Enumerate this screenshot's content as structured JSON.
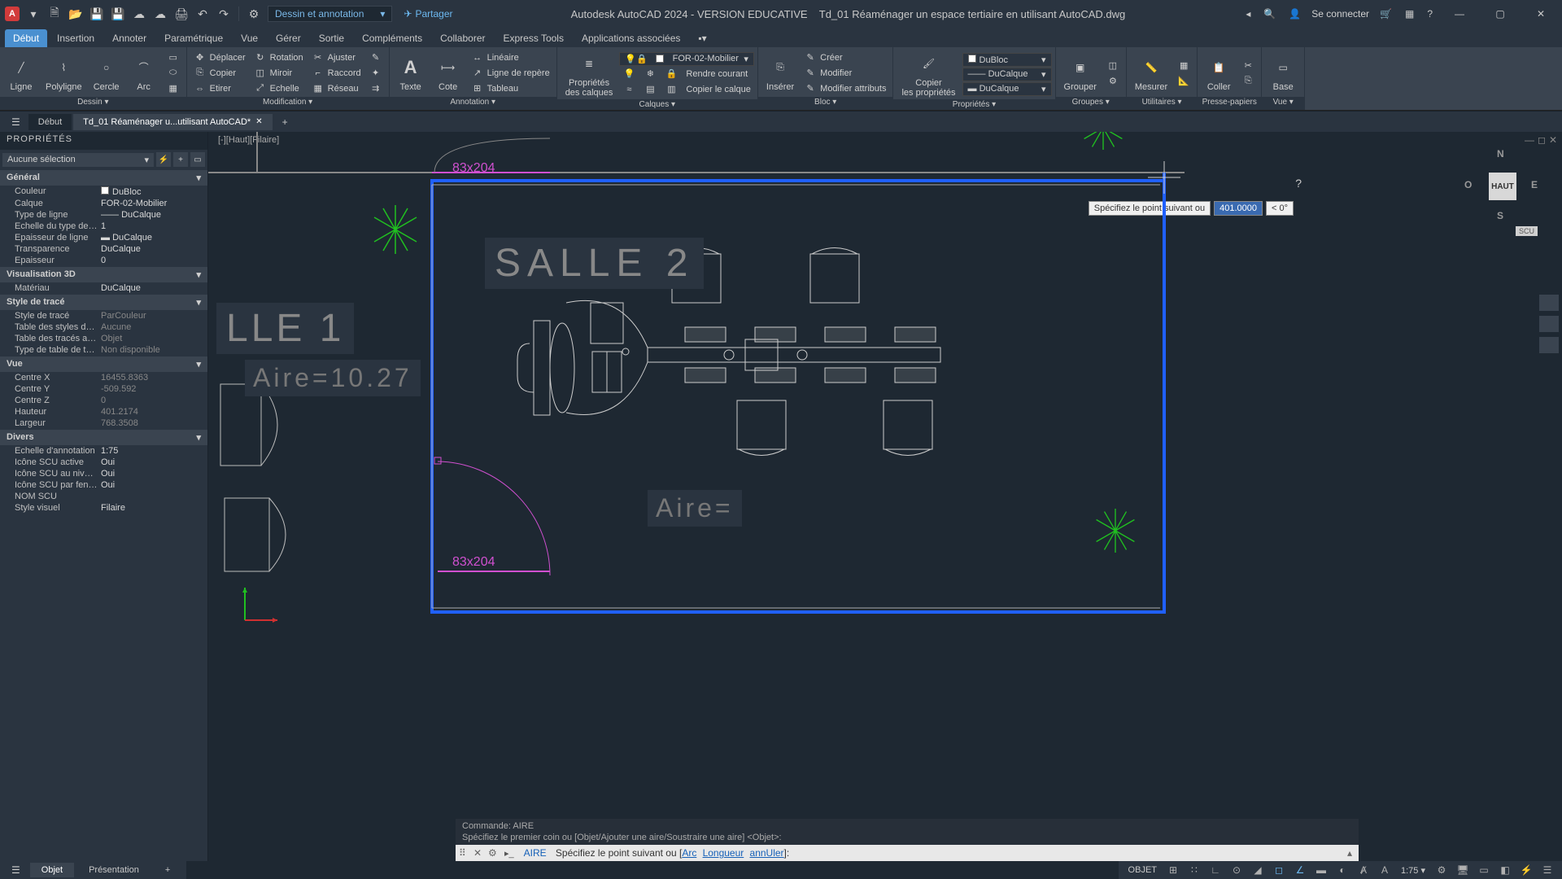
{
  "title": {
    "app": "Autodesk AutoCAD 2024 - VERSION EDUCATIVE",
    "file": "Td_01 Réaménager un espace tertiaire en utilisant AutoCAD.dwg",
    "workspace": "Dessin et annotation",
    "share": "Partager",
    "signin": "Se connecter"
  },
  "menu": {
    "start": "Début",
    "tabs": [
      "Insertion",
      "Annoter",
      "Paramétrique",
      "Vue",
      "Gérer",
      "Sortie",
      "Compléments",
      "Collaborer",
      "Express Tools",
      "Applications associées"
    ]
  },
  "ribbon": {
    "dessin": {
      "title": "Dessin ▾",
      "ligne": "Ligne",
      "polyligne": "Polyligne",
      "cercle": "Cercle",
      "arc": "Arc"
    },
    "modif": {
      "title": "Modification ▾",
      "deplacer": "Déplacer",
      "rotation": "Rotation",
      "ajuster": "Ajuster",
      "copier": "Copier",
      "miroir": "Miroir",
      "raccord": "Raccord",
      "etirer": "Etirer",
      "echelle": "Echelle",
      "reseau": "Réseau"
    },
    "annot": {
      "title": "Annotation ▾",
      "texte": "Texte",
      "cote": "Cote",
      "lineaire": "Linéaire",
      "repere": "Ligne de repère",
      "tableau": "Tableau"
    },
    "calques": {
      "title": "Calques ▾",
      "prop": "Propriétés\ndes calques",
      "current": "FOR-02-Mobilier",
      "courant": "Rendre courant",
      "copier": "Copier le calque"
    },
    "bloc": {
      "title": "Bloc ▾",
      "inserer": "Insérer",
      "creer": "Créer",
      "modifier": "Modifier",
      "attrib": "Modifier attributs"
    },
    "proprietes": {
      "title": "Propriétés ▾",
      "copier": "Copier\nles propriétés",
      "color": "DuBloc",
      "ltype": "DuCalque",
      "lweight": "DuCalque"
    },
    "groupes": {
      "title": "Groupes ▾",
      "grouper": "Grouper"
    },
    "util": {
      "title": "Utilitaires ▾",
      "mesurer": "Mesurer"
    },
    "presse": {
      "title": "Presse-papiers",
      "coller": "Coller"
    },
    "vue": {
      "title": "Vue ▾",
      "base": "Base"
    }
  },
  "filetabs": {
    "debut": "Début",
    "active": "Td_01 Réaménager u...utilisant AutoCAD*"
  },
  "canvas": {
    "viewlabel": "[-][Haut][Filaire]",
    "cube_top": "HAUT",
    "n": "N",
    "s": "S",
    "e": "E",
    "o": "O",
    "scu": "SCU",
    "dyninput_label": "Spécifiez le point suivant ou",
    "dyninput_dist": "401.0000",
    "dyninput_angle": "< 0°",
    "qmark": "?",
    "salle1": "LLE 1",
    "salle2": "SALLE 2",
    "aire1": "Aire=10.27",
    "aire2": "Aire=",
    "dim": "83x204"
  },
  "cmd": {
    "hist1": "Commande: AIRE",
    "hist2": "Spécifiez le premier coin ou [Objet/Ajouter une aire/Soustraire une aire] <Objet>:",
    "prefix": "AIRE",
    "prompt": "Spécifiez le point suivant ou [",
    "o1": "Arc",
    "o2": "Longueur",
    "o3": "annUler",
    "suffix": "]:"
  },
  "props": {
    "title": "PROPRIÉTÉS",
    "sel": "Aucune sélection",
    "general": "Général",
    "couleur_l": "Couleur",
    "couleur_v": "DuBloc",
    "calque_l": "Calque",
    "calque_v": "FOR-02-Mobilier",
    "tligne_l": "Type de ligne",
    "tligne_v": "DuCalque",
    "echtl_l": "Echelle du type de li...",
    "echtl_v": "1",
    "epligne_l": "Epaisseur de ligne",
    "epligne_v": "DuCalque",
    "transp_l": "Transparence",
    "transp_v": "DuCalque",
    "epaiss_l": "Epaisseur",
    "epaiss_v": "0",
    "vis3d": "Visualisation 3D",
    "mat_l": "Matériau",
    "mat_v": "DuCalque",
    "strace": "Style de tracé",
    "st_l": "Style de tracé",
    "st_v": "ParCouleur",
    "tst_l": "Table des styles de tr...",
    "tst_v": "Aucune",
    "tta_l": "Table des tracés atta...",
    "tta_v": "Objet",
    "ttt_l": "Type de table de tracé",
    "ttt_v": "Non disponible",
    "vue": "Vue",
    "cx_l": "Centre X",
    "cx_v": "16455.8363",
    "cy_l": "Centre Y",
    "cy_v": "-509.592",
    "cz_l": "Centre Z",
    "cz_v": "0",
    "h_l": "Hauteur",
    "h_v": "401.2174",
    "w_l": "Largeur",
    "w_v": "768.3508",
    "divers": "Divers",
    "ea_l": "Echelle d'annotation",
    "ea_v": "1:75",
    "isa_l": "Icône SCU active",
    "isa_v": "Oui",
    "isn_l": "Icône SCU au niveau...",
    "isn_v": "Oui",
    "isf_l": "Icône SCU par fenêtre",
    "isf_v": "Oui",
    "ns_l": "NOM SCU",
    "ns_v": "",
    "sv_l": "Style visuel",
    "sv_v": "Filaire"
  },
  "bottom": {
    "objet": "Objet",
    "pres": "Présentation"
  },
  "status": {
    "objet": "OBJET",
    "scale": "1:75 ▾"
  }
}
